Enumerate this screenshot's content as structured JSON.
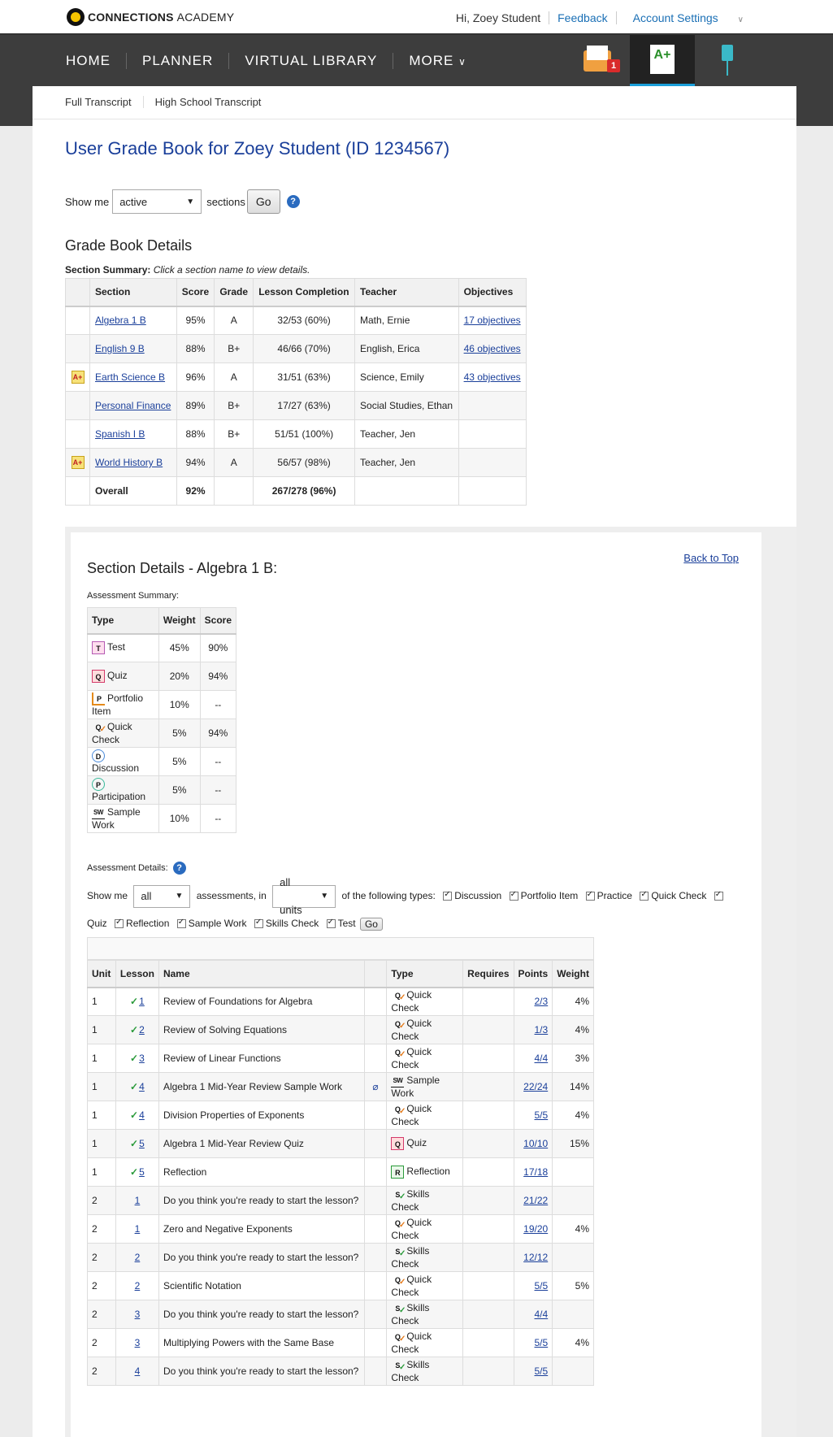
{
  "header": {
    "brand_bold": "CONNECTIONS",
    "brand_light": "ACADEMY",
    "greeting": "Hi, Zoey Student",
    "feedback": "Feedback",
    "account_settings": "Account Settings"
  },
  "nav": {
    "items": [
      "HOME",
      "PLANNER",
      "VIRTUAL LIBRARY",
      "MORE"
    ],
    "mail_badge": "1",
    "grade_icon_text": "A+"
  },
  "subnav": {
    "full_transcript": "Full Transcript",
    "hs_transcript": "High School Transcript"
  },
  "page": {
    "title": "User Grade Book for Zoey Student (ID 1234567)",
    "show_me": "Show me",
    "sections_select": "active",
    "sections": "sections",
    "go": "Go",
    "help": "?"
  },
  "gradebook": {
    "heading": "Grade Book Details",
    "summary_bold": "Section Summary:",
    "summary_hint": "Click a section name to view details.",
    "columns": [
      "Section",
      "Score",
      "Grade",
      "Lesson Completion",
      "Teacher",
      "Objectives"
    ],
    "rows": [
      {
        "flag": "",
        "section": "Algebra 1 B",
        "score": "95%",
        "grade": "A",
        "completion": "32/53 (60%)",
        "teacher": "Math, Ernie",
        "objectives": "17 objectives"
      },
      {
        "flag": "",
        "section": "English 9 B",
        "score": "88%",
        "grade": "B+",
        "completion": "46/66 (70%)",
        "teacher": "English, Erica",
        "objectives": "46 objectives"
      },
      {
        "flag": "A+",
        "section": "Earth Science B",
        "score": "96%",
        "grade": "A",
        "completion": "31/51 (63%)",
        "teacher": "Science, Emily",
        "objectives": "43 objectives"
      },
      {
        "flag": "",
        "section": "Personal Finance",
        "score": "89%",
        "grade": "B+",
        "completion": "17/27 (63%)",
        "teacher": "Social Studies, Ethan",
        "objectives": ""
      },
      {
        "flag": "",
        "section": "Spanish I B",
        "score": "88%",
        "grade": "B+",
        "completion": "51/51 (100%)",
        "teacher": "Teacher, Jen",
        "objectives": ""
      },
      {
        "flag": "A+",
        "section": "World History B",
        "score": "94%",
        "grade": "A",
        "completion": "56/57 (98%)",
        "teacher": "Teacher, Jen",
        "objectives": ""
      }
    ],
    "overall": {
      "label": "Overall",
      "score": "92%",
      "completion": "267/278 (96%)"
    }
  },
  "details": {
    "back_to_top": "Back to Top",
    "heading": "Section Details - Algebra 1 B:",
    "assessment_summary": "Assessment Summary:",
    "as_columns": [
      "Type",
      "Weight",
      "Score"
    ],
    "as_rows": [
      {
        "icon": "test-icon",
        "icls": "test",
        "glyph": "T",
        "type": "Test",
        "weight": "45%",
        "score": "90%"
      },
      {
        "icon": "quiz-icon",
        "icls": "quiz",
        "glyph": "Q",
        "type": "Quiz",
        "weight": "20%",
        "score": "94%"
      },
      {
        "icon": "portfolio-icon",
        "icls": "portfolio",
        "glyph": "P",
        "type": "Portfolio Item",
        "weight": "10%",
        "score": "--"
      },
      {
        "icon": "quick-check-icon",
        "icls": "qc",
        "glyph": "Q",
        "type": "Quick Check",
        "weight": "5%",
        "score": "94%"
      },
      {
        "icon": "discussion-icon",
        "icls": "disc",
        "glyph": "D",
        "type": "Discussion",
        "weight": "5%",
        "score": "--"
      },
      {
        "icon": "participation-icon",
        "icls": "part",
        "glyph": "P",
        "type": "Participation",
        "weight": "5%",
        "score": "--"
      },
      {
        "icon": "sample-work-icon",
        "icls": "sw",
        "glyph": "SW",
        "type": "Sample Work",
        "weight": "10%",
        "score": "--"
      }
    ],
    "assessment_details": "Assessment Details:",
    "filter": {
      "show_me": "Show me",
      "count_select": "all",
      "assessments_in": "assessments, in",
      "units_select": "all units",
      "of_types": "of the following types:",
      "types": [
        "Discussion",
        "Portfolio Item",
        "Practice",
        "Quick Check",
        "Quiz",
        "Reflection",
        "Sample Work",
        "Skills Check",
        "Test"
      ],
      "go": "Go"
    },
    "ad_columns": [
      "Unit",
      "Lesson",
      "Name",
      "",
      "Type",
      "Requires",
      "Points",
      "Weight"
    ],
    "ad_rows": [
      {
        "unit": "1",
        "check": true,
        "lesson": "1",
        "name": "Review of Foundations for Algebra",
        "attach": false,
        "icls": "qc",
        "glyph": "Q",
        "icon": "quick-check-icon",
        "type": "Quick Check",
        "requires": "",
        "points": "2/3",
        "weight": "4%"
      },
      {
        "unit": "1",
        "check": true,
        "lesson": "2",
        "name": "Review of Solving Equations",
        "attach": false,
        "icls": "qc",
        "glyph": "Q",
        "icon": "quick-check-icon",
        "type": "Quick Check",
        "requires": "",
        "points": "1/3",
        "weight": "4%"
      },
      {
        "unit": "1",
        "check": true,
        "lesson": "3",
        "name": "Review of Linear Functions",
        "attach": false,
        "icls": "qc",
        "glyph": "Q",
        "icon": "quick-check-icon",
        "type": "Quick Check",
        "requires": "",
        "points": "4/4",
        "weight": "3%"
      },
      {
        "unit": "1",
        "check": true,
        "lesson": "4",
        "name": "Algebra 1 Mid-Year Review Sample Work",
        "attach": true,
        "icls": "sw",
        "glyph": "SW",
        "icon": "sample-work-icon",
        "type": "Sample Work",
        "requires": "",
        "points": "22/24",
        "weight": "14%"
      },
      {
        "unit": "1",
        "check": true,
        "lesson": "4",
        "name": "Division Properties of Exponents",
        "attach": false,
        "icls": "qc",
        "glyph": "Q",
        "icon": "quick-check-icon",
        "type": "Quick Check",
        "requires": "",
        "points": "5/5",
        "weight": "4%"
      },
      {
        "unit": "1",
        "check": true,
        "lesson": "5",
        "name": "Algebra 1 Mid-Year Review Quiz",
        "attach": false,
        "icls": "quiz",
        "glyph": "Q",
        "icon": "quiz-icon",
        "type": "Quiz",
        "requires": "",
        "points": "10/10",
        "weight": "15%"
      },
      {
        "unit": "1",
        "check": true,
        "lesson": "5",
        "name": "Reflection",
        "attach": false,
        "icls": "refl",
        "glyph": "R",
        "icon": "reflection-icon",
        "type": "Reflection",
        "requires": "",
        "points": "17/18",
        "weight": ""
      },
      {
        "unit": "2",
        "check": false,
        "lesson": "1",
        "name": "Do you think you're ready to start the lesson?",
        "attach": false,
        "icls": "skills",
        "glyph": "S",
        "icon": "skills-check-icon",
        "type": "Skills Check",
        "requires": "",
        "points": "21/22",
        "weight": ""
      },
      {
        "unit": "2",
        "check": false,
        "lesson": "1",
        "name": "Zero and Negative Exponents",
        "attach": false,
        "icls": "qc",
        "glyph": "Q",
        "icon": "quick-check-icon",
        "type": "Quick Check",
        "requires": "",
        "points": "19/20",
        "weight": "4%"
      },
      {
        "unit": "2",
        "check": false,
        "lesson": "2",
        "name": "Do you think you're ready to start the lesson?",
        "attach": false,
        "icls": "skills",
        "glyph": "S",
        "icon": "skills-check-icon",
        "type": "Skills Check",
        "requires": "",
        "points": "12/12",
        "weight": ""
      },
      {
        "unit": "2",
        "check": false,
        "lesson": "2",
        "name": "Scientific Notation",
        "attach": false,
        "icls": "qc",
        "glyph": "Q",
        "icon": "quick-check-icon",
        "type": "Quick Check",
        "requires": "",
        "points": "5/5",
        "weight": "5%"
      },
      {
        "unit": "2",
        "check": false,
        "lesson": "3",
        "name": "Do you think you're ready to start the lesson?",
        "attach": false,
        "icls": "skills",
        "glyph": "S",
        "icon": "skills-check-icon",
        "type": "Skills Check",
        "requires": "",
        "points": "4/4",
        "weight": ""
      },
      {
        "unit": "2",
        "check": false,
        "lesson": "3",
        "name": "Multiplying Powers with the Same Base",
        "attach": false,
        "icls": "qc",
        "glyph": "Q",
        "icon": "quick-check-icon",
        "type": "Quick Check",
        "requires": "",
        "points": "5/5",
        "weight": "4%"
      },
      {
        "unit": "2",
        "check": false,
        "lesson": "4",
        "name": "Do you think you're ready to start the lesson?",
        "attach": false,
        "icls": "skills",
        "glyph": "S",
        "icon": "skills-check-icon",
        "type": "Skills Check",
        "requires": "",
        "points": "5/5",
        "weight": ""
      }
    ]
  }
}
